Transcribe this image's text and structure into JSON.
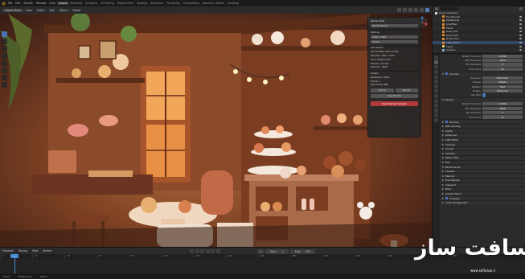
{
  "menubar": {
    "items": [
      "File",
      "Edit",
      "Render",
      "Window",
      "Help"
    ],
    "workspaces": [
      "Layout",
      "Modeling",
      "Sculpting",
      "UV Editing",
      "Texture Paint",
      "Shading",
      "Animation",
      "Rendering",
      "Compositing",
      "Geometry Nodes",
      "Scripting"
    ],
    "active_workspace": "Layout"
  },
  "viewport_header": {
    "mode": "Object Mode",
    "menus": [
      "View",
      "Select",
      "Add",
      "Object"
    ],
    "transform": "Global"
  },
  "hud": {
    "line1": "User Perspective",
    "line2": "(1) Collection | Bakery"
  },
  "render_panel": {
    "title": "Render Stats",
    "field1": "Render Result",
    "section1": "Settings",
    "field2": "1920 x 1080",
    "field3": "Cycles",
    "section2": "Last Render",
    "lines": [
      "GPU: NVIDIA GeForce RTX",
      "Samples: 1024 / 1024",
      "Time: 00:02:14.56",
      "Memory: 3.2 GB",
      "Denoiser: OptiX"
    ],
    "section3": "Output",
    "out_lines": [
      "Resolution: 100%",
      "Frame: 1",
      "File Format: PNG"
    ],
    "buttons": [
      "Cancel",
      "Render"
    ],
    "btn_full": "Save Render",
    "red_button": "Reset Render Samples"
  },
  "outliner": {
    "rows": [
      "Scene Collection",
      "FloorBoards",
      "WallBoards",
      "ShelfMain",
      "Plants",
      "Glass_001",
      "Glass_002",
      "Bread_Tray",
      "Cake_Stand",
      "Lights",
      "Camera"
    ],
    "selected_index": 8
  },
  "properties": {
    "rows": [
      {
        "type": "field",
        "label": "Noise Threshold",
        "value": "0.0100"
      },
      {
        "type": "field",
        "label": "Max Samples",
        "value": "1024"
      },
      {
        "type": "field",
        "label": "Min Samples",
        "value": "0"
      },
      {
        "type": "field",
        "label": "Time Limit",
        "value": "0 s"
      },
      {
        "type": "section",
        "label": "Denoise",
        "open": true,
        "check": true
      },
      {
        "type": "field",
        "label": "Denoiser",
        "value": "Automatic"
      },
      {
        "type": "field",
        "label": "Passes",
        "value": "Albedo"
      },
      {
        "type": "field",
        "label": "Prefilter",
        "value": "Fast"
      },
      {
        "type": "field",
        "label": "Quality",
        "value": "Balanced"
      },
      {
        "type": "field",
        "label": "Use GPU",
        "value": ""
      },
      {
        "type": "section",
        "label": "Render",
        "open": true,
        "check": false
      },
      {
        "type": "field",
        "label": "Noise Threshold",
        "value": "0.0100"
      },
      {
        "type": "field",
        "label": "Max Samples",
        "value": "4096"
      },
      {
        "type": "field",
        "label": "Min Samples",
        "value": "0"
      },
      {
        "type": "field",
        "label": "Time Limit",
        "value": "0 s"
      },
      {
        "type": "section",
        "label": "Denoise",
        "open": false,
        "check": true
      },
      {
        "type": "section",
        "label": "Path Guiding",
        "open": false,
        "check": false
      },
      {
        "type": "section",
        "label": "Lights",
        "open": false,
        "check": false
      },
      {
        "type": "section",
        "label": "Advanced",
        "open": false,
        "check": false
      },
      {
        "type": "section",
        "label": "Light Paths",
        "open": false,
        "check": false
      },
      {
        "type": "section",
        "label": "Volumes",
        "open": false,
        "check": false
      },
      {
        "type": "section",
        "label": "Curves",
        "open": false,
        "check": false
      },
      {
        "type": "section",
        "label": "Simplify",
        "open": false,
        "check": false
      },
      {
        "type": "section",
        "label": "Motion Blur",
        "open": false,
        "check": false
      },
      {
        "type": "section",
        "label": "Film",
        "open": false,
        "check": false
      },
      {
        "type": "section",
        "label": "Performance",
        "open": true,
        "check": false
      },
      {
        "type": "section",
        "label": "Threads",
        "open": false,
        "check": false
      },
      {
        "type": "section",
        "label": "Memory",
        "open": false,
        "check": false
      },
      {
        "type": "section",
        "label": "Final Render",
        "open": false,
        "check": false
      },
      {
        "type": "section",
        "label": "Viewport",
        "open": false,
        "check": false
      },
      {
        "type": "section",
        "label": "Bake",
        "open": false,
        "check": false
      },
      {
        "type": "section",
        "label": "Grease Pencil",
        "open": false,
        "check": false
      },
      {
        "type": "section",
        "label": "Freestyle",
        "open": false,
        "check": true
      },
      {
        "type": "section",
        "label": "Color Management",
        "open": false,
        "check": false
      }
    ]
  },
  "timeline_header": {
    "items": [
      "Playback",
      "Keying",
      "View",
      "Marker"
    ],
    "start_label": "Start",
    "start": "1",
    "end_label": "End",
    "end": "250"
  },
  "timeline": {
    "ticks": [
      "0",
      "20",
      "40",
      "60",
      "80",
      "100",
      "120",
      "140",
      "160",
      "180",
      "200",
      "220",
      "240",
      "260",
      "280",
      "300"
    ],
    "current_frame": "1"
  },
  "status": {
    "left": "Select",
    "mid": "Rotate View",
    "right": "Object"
  },
  "watermark": {
    "text": "سافت ساز",
    "sub": "www.softsaaz.ir"
  },
  "colors": {
    "accent": "#4772b3",
    "playhead": "#4a8bd6",
    "warn": "#b23a3a"
  }
}
